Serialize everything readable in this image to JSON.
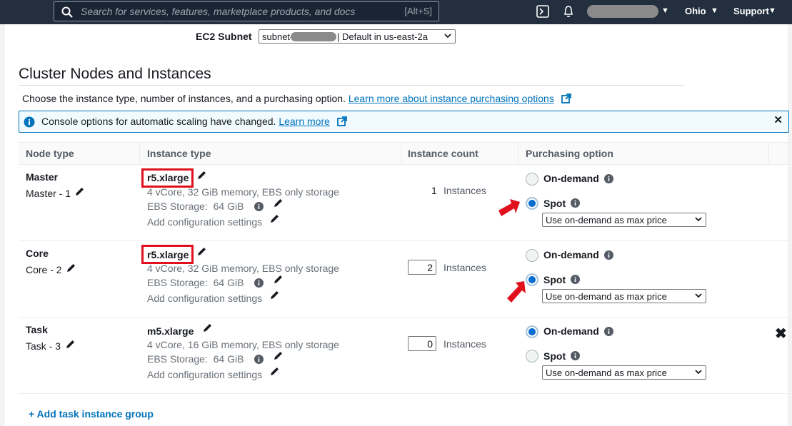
{
  "search": {
    "placeholder": "Search for services, features, marketplace products, and docs",
    "shortcut": "[Alt+S]"
  },
  "nav": {
    "region": "Ohio",
    "support": "Support"
  },
  "subnet": {
    "label": "EC2 Subnet",
    "prefix": "subnet-",
    "suffix": "| Default in us-east-2a"
  },
  "section": {
    "title": "Cluster Nodes and Instances",
    "description": "Choose the instance type, number of instances, and a purchasing option.",
    "learn_link": "Learn more about instance purchasing options"
  },
  "alert": {
    "message": "Console options for automatic scaling have changed.",
    "link": "Learn more"
  },
  "table": {
    "headers": [
      "Node type",
      "Instance type",
      "Instance count",
      "Purchasing option"
    ],
    "instances_label": "Instances",
    "ebs_label": "EBS Storage:",
    "config_label": "Add configuration settings",
    "ondemand_label": "On-demand",
    "spot_label": "Spot",
    "price_option": "Use on-demand as max price",
    "rows": [
      {
        "name": "Master",
        "count_label": "Master - 1",
        "instance_type": "r5.xlarge",
        "spec": "4 vCore, 32 GiB memory, EBS only storage",
        "ebs": "64 GiB",
        "count": "1",
        "purchasing": "Spot"
      },
      {
        "name": "Core",
        "count_label": "Core - 2",
        "instance_type": "r5.xlarge",
        "spec": "4 vCore, 32 GiB memory, EBS only storage",
        "ebs": "64 GiB",
        "count": "2",
        "purchasing": "Spot"
      },
      {
        "name": "Task",
        "count_label": "Task - 3",
        "instance_type": "m5.xlarge",
        "spec": "4 vCore, 16 GiB memory, EBS only storage",
        "ebs": "64 GiB",
        "count": "0",
        "purchasing": "On-demand"
      }
    ]
  },
  "add_task": "+ Add task instance group",
  "colors": {
    "nav_bg": "#232f3e",
    "link": "#0073bb",
    "highlight": "#e0101c",
    "radio_selected": "#0a6ed1"
  }
}
